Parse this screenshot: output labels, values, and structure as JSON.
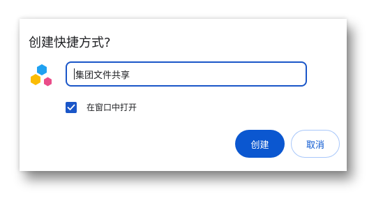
{
  "dialog": {
    "title": "创建快捷方式?",
    "app_icon": "hexagons-app-icon",
    "name_input": {
      "value": "集团文件共享"
    },
    "open_in_window": {
      "label": "在窗口中打开",
      "checked": true
    },
    "buttons": {
      "create": "创建",
      "cancel": "取消"
    }
  },
  "colors": {
    "accent": "#0b57d0",
    "input_border": "#1a56c8",
    "cancel_border": "#a8c7fa",
    "icon_blue": "#1fa1f1",
    "icon_yellow": "#fbbc04",
    "icon_pink": "#ea4c89"
  }
}
